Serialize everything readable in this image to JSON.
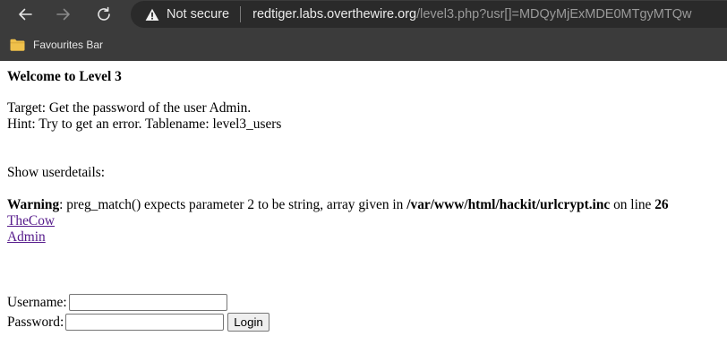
{
  "browser": {
    "security_label": "Not secure",
    "url_host": "redtiger.labs.overthewire.org",
    "url_path": "/level3.php?usr[]=MDQyMjExMDE0MTgyMTQw",
    "favourites_label": "Favourites Bar",
    "icons": {
      "back": "back-arrow-icon",
      "forward": "forward-arrow-icon",
      "reload": "reload-icon",
      "security": "warning-triangle-icon",
      "favourites": "folder-icon"
    },
    "colors": {
      "chrome": "#3b3b3b",
      "address_bar": "#2a2a2a",
      "folder": "#f0c14b"
    }
  },
  "page": {
    "heading": "Welcome to Level 3",
    "target": "Target: Get the password of the user Admin.",
    "hint": "Hint: Try to get an error. Tablename: level3_users",
    "show_details": "Show userdetails:",
    "warning": {
      "label": "Warning",
      "message": ": preg_match() expects parameter 2 to be string, array given in ",
      "path": "/var/www/html/hackit/urlcrypt.inc",
      "on_line": " on line ",
      "line_number": "26"
    },
    "users": [
      "TheCow",
      "Admin"
    ],
    "login": {
      "username_label": "Username:",
      "password_label": "Password:",
      "username_value": "",
      "password_value": "",
      "button_label": "Login"
    },
    "colors": {
      "link": "#551a8b"
    }
  }
}
